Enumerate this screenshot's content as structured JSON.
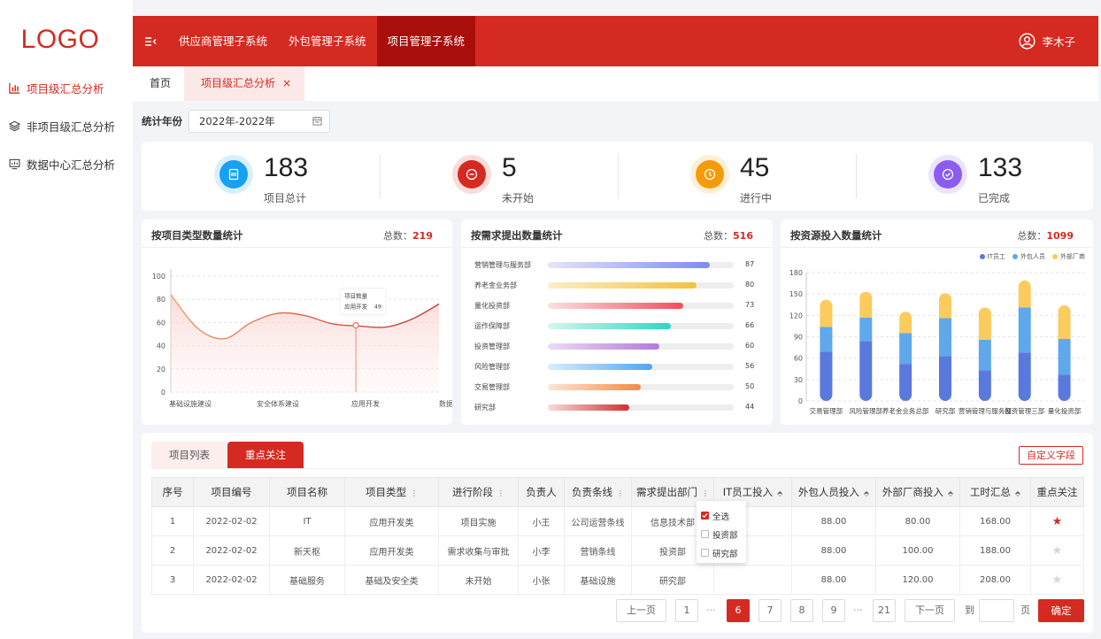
{
  "logo": "LOGO",
  "sidebar": {
    "items": [
      {
        "label": "项目级汇总分析",
        "icon": "bar-chart-icon",
        "active": true
      },
      {
        "label": "非项目级汇总分析",
        "icon": "layers-icon",
        "active": false
      },
      {
        "label": "数据中心汇总分析",
        "icon": "monitor-icon",
        "active": false
      }
    ]
  },
  "header": {
    "tabs": [
      "供应商管理子系统",
      "外包管理子系统",
      "项目管理子系统"
    ],
    "active_tab": 2,
    "user": "李木子"
  },
  "tabbar": {
    "home": "首页",
    "current": "项目级汇总分析",
    "close": "×"
  },
  "filter": {
    "label": "统计年份",
    "value": "2022年-2022年"
  },
  "stats": [
    {
      "value": "183",
      "label": "项目总计",
      "color": "#1aa0f0",
      "ring": "#d9efff",
      "icon": "document-icon"
    },
    {
      "value": "5",
      "label": "未开始",
      "color": "#d42a21",
      "ring": "#fbdcda",
      "icon": "minus-circle-icon"
    },
    {
      "value": "45",
      "label": "进行中",
      "color": "#f59b0b",
      "ring": "#fff0d4",
      "icon": "clock-icon"
    },
    {
      "value": "133",
      "label": "已完成",
      "color": "#8a5cf0",
      "ring": "#ece3ff",
      "icon": "check-circle-icon"
    }
  ],
  "card1": {
    "title": "按项目类型数量统计",
    "total_label": "总数：",
    "total": "219",
    "tooltip_title": "项目数量",
    "tooltip_label": "应用开发",
    "tooltip_value": "49"
  },
  "card2": {
    "title": "按需求提出数量统计",
    "total_label": "总数：",
    "total": "516"
  },
  "card3": {
    "title": "按资源投入数量统计",
    "total_label": "总数：",
    "total": "1099",
    "legend": [
      {
        "label": "IT员工",
        "color": "#5a79dc"
      },
      {
        "label": "外包人员",
        "color": "#5fa8ea"
      },
      {
        "label": "外部厂商",
        "color": "#fccb5e"
      }
    ]
  },
  "chart_data": [
    {
      "type": "line",
      "categories": [
        "基础设施建设",
        "安全体系建设",
        "应用开发",
        "数据开发"
      ],
      "x": [
        0,
        0.3,
        0.6,
        0.9,
        1.2,
        1.5,
        1.8,
        2.1,
        2.4,
        2.7,
        3.0
      ],
      "values": [
        84,
        55,
        46,
        60,
        68,
        66,
        59,
        57,
        56,
        63,
        76
      ],
      "ylim": [
        0,
        100
      ],
      "yticks": [
        0,
        20,
        40,
        60,
        80,
        100
      ],
      "tooltip_point": {
        "category": "应用开发",
        "value": 49
      },
      "grid": true
    },
    {
      "type": "bar",
      "orientation": "horizontal",
      "categories": [
        "营销管理与服务部",
        "养老金业务部",
        "量化投资部",
        "运作保障部",
        "投资管理部",
        "风险管理部",
        "交易管理部",
        "研究部"
      ],
      "values": [
        87,
        80,
        73,
        66,
        60,
        56,
        50,
        44
      ],
      "max": 100,
      "colors": [
        [
          "#e6e4fb",
          "#7f8cf0"
        ],
        [
          "#fbeec7",
          "#f3c13f"
        ],
        [
          "#fbe0e2",
          "#ee4f5c"
        ],
        [
          "#d2f8ef",
          "#2ed7c2"
        ],
        [
          "#ecdcf6",
          "#b27ad8"
        ],
        [
          "#d9eefc",
          "#4fa5f3"
        ],
        [
          "#fde6d7",
          "#f58a45"
        ],
        [
          "#f7dcdc",
          "#cf3030"
        ]
      ]
    },
    {
      "type": "bar",
      "stacked": true,
      "categories": [
        "交易管理部",
        "风险管理部",
        "养老金业务总部",
        "研究部",
        "营销管理与服务部",
        "投资管理三部",
        "量化投资部"
      ],
      "series": [
        {
          "name": "IT员工",
          "values": [
            69,
            84,
            52,
            63,
            43,
            68,
            37
          ]
        },
        {
          "name": "外包人员",
          "values": [
            35,
            33,
            43,
            53,
            43,
            63,
            50
          ]
        },
        {
          "name": "外部厂商",
          "values": [
            38,
            36,
            30,
            35,
            45,
            38,
            47
          ]
        }
      ],
      "ylim": [
        0,
        180
      ],
      "yticks": [
        0,
        30,
        60,
        90,
        120,
        150,
        180
      ],
      "grid": true
    }
  ],
  "panel": {
    "tabs": [
      "项目列表",
      "重点关注"
    ],
    "active_tab": 1,
    "custom_button": "自定义字段",
    "columns": [
      "序号",
      "项目编号",
      "项目名称",
      "项目类型",
      "进行阶段",
      "负责人",
      "负责条线",
      "需求提出部门",
      "IT员工投入",
      "外包人员投入",
      "外部厂商投入",
      "工时汇总",
      "重点关注"
    ],
    "rows": [
      {
        "no": "1",
        "code": "2022-02-02",
        "name": "IT",
        "type": "应用开发类",
        "stage": "项目实施",
        "owner": "小王",
        "line": "公司运营条线",
        "dept": "信息技术部",
        "it": "",
        "outsource": "88.00",
        "vendor": "80.00",
        "hours": "168.00",
        "starred": true
      },
      {
        "no": "2",
        "code": "2022-02-02",
        "name": "新天枢",
        "type": "应用开发类",
        "stage": "需求收集与审批",
        "owner": "小李",
        "line": "营销条线",
        "dept": "投资部",
        "it": "",
        "outsource": "88.00",
        "vendor": "100.00",
        "hours": "188.00",
        "starred": false
      },
      {
        "no": "3",
        "code": "2022-02-02",
        "name": "基础服务",
        "type": "基础及安全类",
        "stage": "未开始",
        "owner": "小张",
        "line": "基础设施",
        "dept": "研究部",
        "it": "",
        "outsource": "88.00",
        "vendor": "120.00",
        "hours": "208.00",
        "starred": false
      }
    ],
    "dropdown": [
      {
        "label": "全选",
        "checked": true
      },
      {
        "label": "投资部",
        "checked": false
      },
      {
        "label": "研究部",
        "checked": false
      }
    ]
  },
  "pager": {
    "prev": "上一页",
    "pages": [
      "1",
      "6",
      "7",
      "8",
      "9",
      "21"
    ],
    "ellipsis": "···",
    "current": "6",
    "next": "下一页",
    "goto_label": "到",
    "page_unit": "页",
    "confirm": "确定"
  }
}
